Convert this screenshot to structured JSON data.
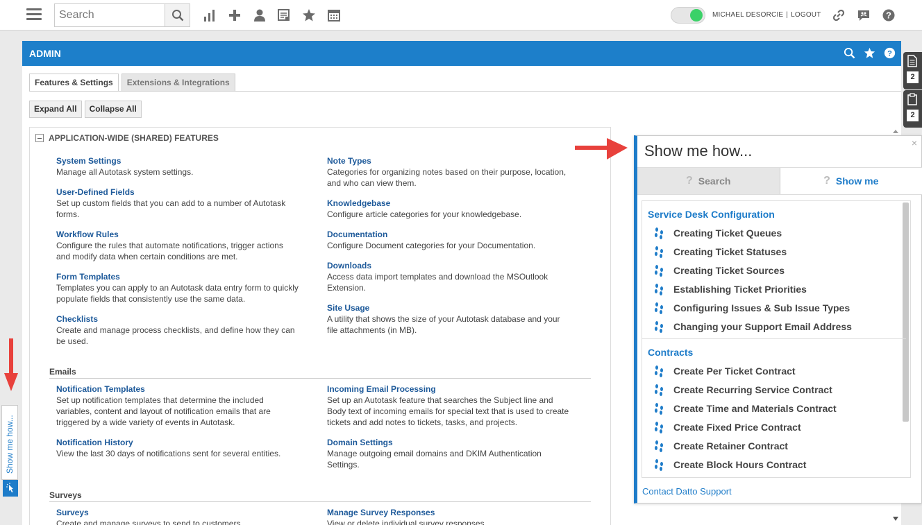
{
  "topbar": {
    "search_placeholder": "Search",
    "user_name": "MICHAEL DESORCIE",
    "separator": "|",
    "logout_label": "LOGOUT"
  },
  "admin": {
    "title": "ADMIN",
    "tabs": [
      {
        "label": "Features & Settings",
        "active": true
      },
      {
        "label": "Extensions & Integrations",
        "active": false
      }
    ],
    "expand_all": "Expand All",
    "collapse_all": "Collapse All",
    "section_header": "APPLICATION-WIDE (SHARED) FEATURES",
    "left_items": [
      {
        "title": "System Settings",
        "desc": "Manage all Autotask system settings."
      },
      {
        "title": "User-Defined Fields",
        "desc": "Set up custom fields that you can add to a number of Autotask forms."
      },
      {
        "title": "Workflow Rules",
        "desc": "Configure the rules that automate notifications, trigger actions and modify data when certain conditions are met."
      },
      {
        "title": "Form Templates",
        "desc": "Templates you can apply to an Autotask data entry form to quickly populate fields that consistently use the same data."
      },
      {
        "title": "Checklists",
        "desc": "Create and manage process checklists, and define how they can be used."
      }
    ],
    "right_items": [
      {
        "title": "Note Types",
        "desc": "Categories for organizing notes based on their purpose, location, and who can view them."
      },
      {
        "title": "Knowledgebase",
        "desc": "Configure article categories for your knowledgebase."
      },
      {
        "title": "Documentation",
        "desc": "Configure Document categories for your Documentation."
      },
      {
        "title": "Downloads",
        "desc": "Access data import templates and download the MSOutlook Extension."
      },
      {
        "title": "Site Usage",
        "desc": "A utility that shows the size of your Autotask database and your file attachments (in MB)."
      }
    ],
    "emails": {
      "title": "Emails",
      "items": [
        {
          "title": "Notification Templates",
          "desc": "Set up notification templates that determine the included variables, content and layout of notification emails that are triggered by a wide variety of events in Autotask."
        },
        {
          "title": "Incoming Email Processing",
          "desc": "Set up an Autotask feature that searches the Subject line and Body text of incoming emails for special text that is used to create tickets and add notes to tickets, tasks, and projects."
        },
        {
          "title": "Notification History",
          "desc": "View the last 30 days of notifications sent for several entities."
        },
        {
          "title": "Domain Settings",
          "desc": "Manage outgoing email domains and DKIM Authentication Settings."
        }
      ]
    },
    "surveys": {
      "title": "Surveys",
      "items": [
        {
          "title": "Surveys",
          "desc": "Create and manage surveys to send to customers."
        },
        {
          "title": "Manage Survey Responses",
          "desc": "View or delete individual survey responses."
        }
      ]
    }
  },
  "side_widgets": [
    {
      "icon": "document-icon",
      "count": "2"
    },
    {
      "icon": "clipboard-icon",
      "count": "2"
    }
  ],
  "left_tab": {
    "label": "Show me how..."
  },
  "show_me_how": {
    "title": "Show me how...",
    "close": "×",
    "tab_search": "Search",
    "tab_show": "Show me",
    "categories": [
      {
        "name": "Service Desk Configuration",
        "items": [
          "Creating Ticket Queues",
          "Creating Ticket Statuses",
          "Creating Ticket Sources",
          "Establishing Ticket Priorities",
          "Configuring Issues & Sub Issue Types",
          "Changing your Support Email Address"
        ]
      },
      {
        "name": "Contracts",
        "items": [
          "Create Per Ticket Contract",
          "Create Recurring Service Contract",
          "Create Time and Materials Contract",
          "Create Fixed Price Contract",
          "Create Retainer Contract",
          "Create Block Hours Contract"
        ]
      }
    ],
    "footer": "Contact Datto Support"
  },
  "colors": {
    "accent": "#1d7fca",
    "link": "#1e5a9a",
    "arrow": "#e8413c",
    "toggle_on": "#3bd168"
  }
}
